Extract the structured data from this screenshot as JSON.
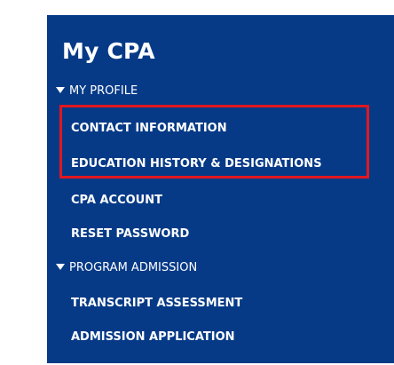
{
  "menu": {
    "title": "My CPA",
    "sections": [
      {
        "header": "MY PROFILE",
        "items": [
          "CONTACT INFORMATION",
          "EDUCATION HISTORY & DESIGNATIONS",
          "CPA ACCOUNT",
          "RESET PASSWORD"
        ]
      },
      {
        "header": "PROGRAM ADMISSION",
        "items": [
          "TRANSCRIPT ASSESSMENT",
          "ADMISSION APPLICATION"
        ]
      }
    ]
  },
  "colors": {
    "panel_background": "#063a87",
    "text": "#ffffff",
    "highlight_border": "#e0171f"
  },
  "icons": {
    "expanded": "caret-down-icon"
  }
}
